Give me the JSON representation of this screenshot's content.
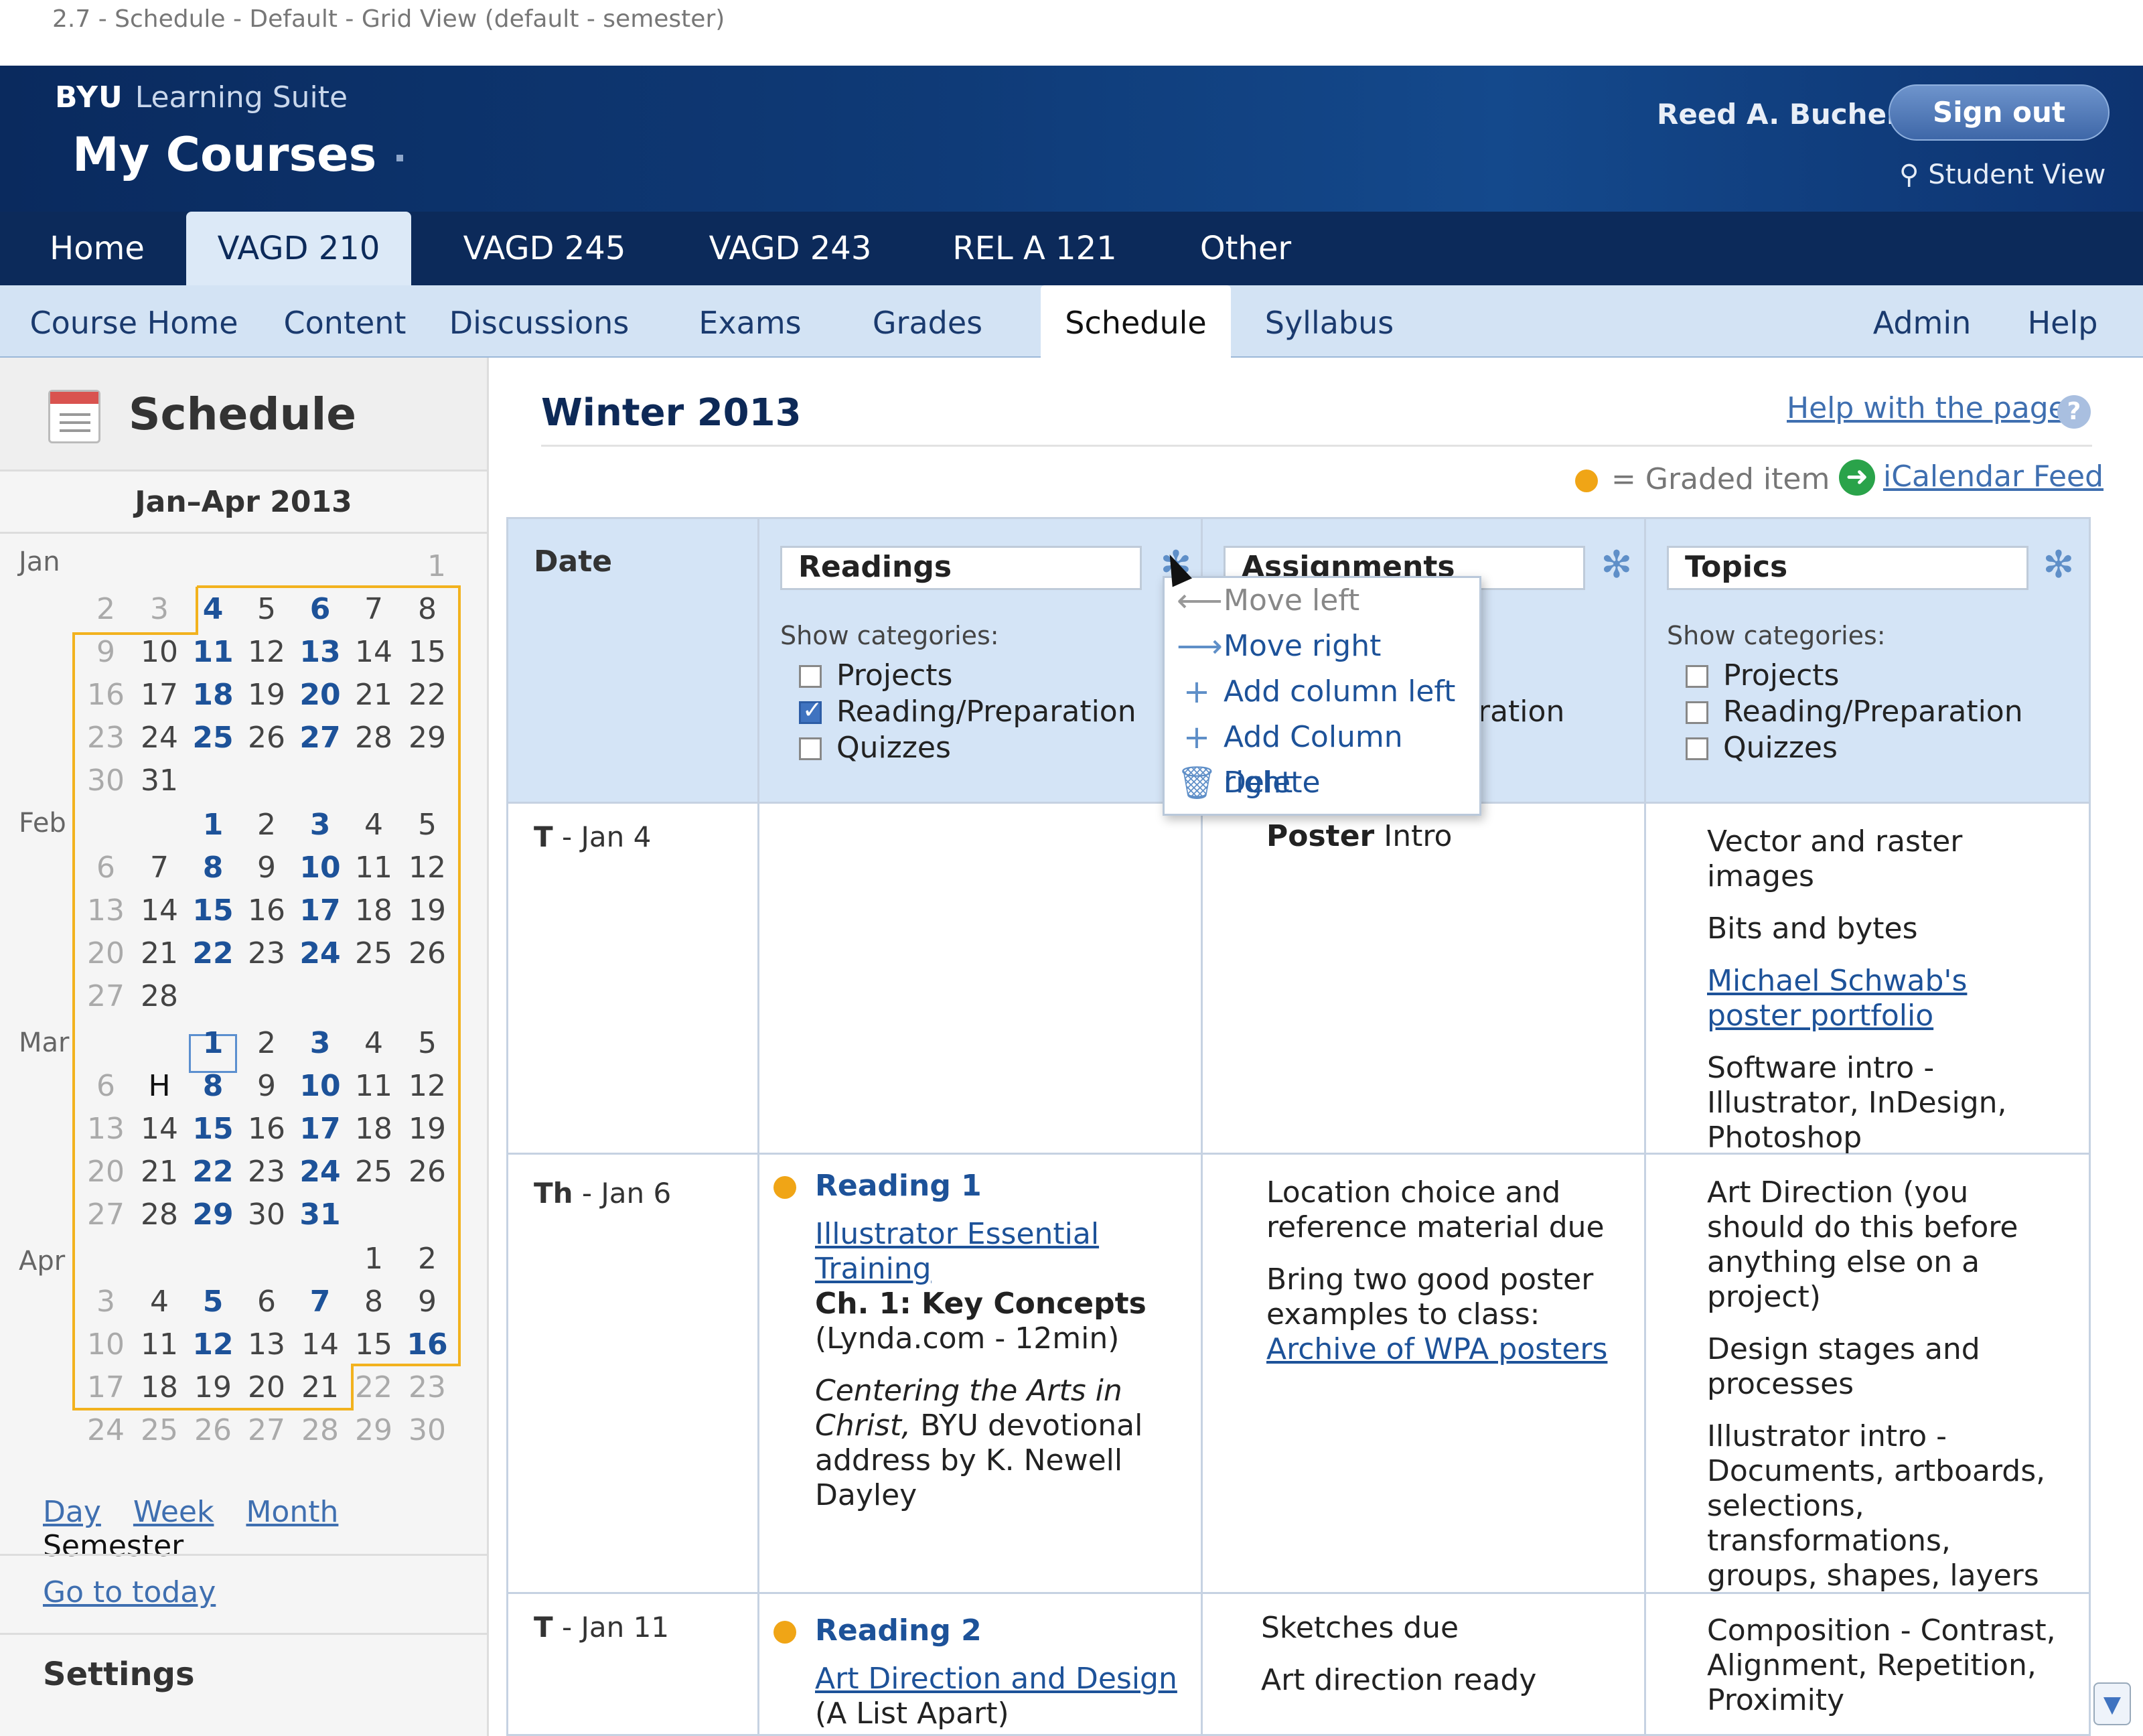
{
  "caption": "2.7 - Schedule - Default - Grid View (default - semester)",
  "header": {
    "brand_byu": "BYU",
    "brand_suite": "Learning Suite",
    "title": "My Courses",
    "user_name": "Reed A. Bucher",
    "sign_out": "Sign out",
    "student_view": "Student View"
  },
  "course_tabs": [
    "Home",
    "VAGD 210",
    "VAGD 245",
    "VAGD 243",
    "REL A 121",
    "Other"
  ],
  "sub_tabs": [
    "Course Home",
    "Content",
    "Discussions",
    "Exams",
    "Grades",
    "Schedule",
    "Syllabus"
  ],
  "sub_right": {
    "admin": "Admin",
    "help": "Help"
  },
  "sidebar": {
    "title": "Schedule",
    "range": "Jan–Apr  2013",
    "months": [
      "Jan",
      "Feb",
      "Mar",
      "Apr"
    ],
    "views": {
      "day": "Day",
      "week": "Week",
      "month": "Month",
      "semester": "Semester"
    },
    "go_today": "Go to today",
    "settings": "Settings"
  },
  "main": {
    "term": "Winter 2013",
    "help": "Help with the page",
    "help_icon": "?",
    "graded_legend": "= Graded item",
    "ical": "iCalendar Feed"
  },
  "grid": {
    "date_header": "Date",
    "columns": [
      {
        "title": "Readings",
        "show_categories": "Show categories:",
        "categories": [
          {
            "label": "Projects",
            "checked": false
          },
          {
            "label": "Reading/Preparation",
            "checked": true
          },
          {
            "label": "Quizzes",
            "checked": false
          }
        ]
      },
      {
        "title": "Assignments",
        "partial_category": "ration"
      },
      {
        "title": "Topics",
        "show_categories": "Show categories:",
        "categories": [
          {
            "label": "Projects",
            "checked": false
          },
          {
            "label": "Reading/Preparation",
            "checked": false
          },
          {
            "label": "Quizzes",
            "checked": false
          }
        ]
      }
    ],
    "rows": [
      {
        "day": "T",
        "date": " - Jan 4",
        "assignments_bold": "Poster",
        "assignments_rest": " Intro",
        "topics": [
          "Vector and raster images",
          "Bits and bytes",
          "Michael Schwab's poster portfolio",
          "Software intro - Illustrator, InDesign, Photoshop"
        ]
      },
      {
        "day": "Th",
        "date": " - Jan 6",
        "reading_title": "Reading 1",
        "reading_link": "Illustrator Essential Training",
        "reading_bold": "Ch. 1: Key Concepts",
        "reading_src": "(Lynda.com - 12min)",
        "reading_italic": "Centering the Arts in Christ,",
        "reading_rest": "BYU devotional address by K. Newell Dayley",
        "assign_1": "Location choice and reference material due",
        "assign_2_text": "Bring two good poster examples to class: ",
        "assign_2_link": "Archive of WPA posters",
        "topics": [
          "Art Direction (you should do this before anything else on a project)",
          "Design stages and processes",
          "Illustrator intro - Documents, artboards, selections, transformations, groups, shapes, layers"
        ]
      },
      {
        "day": "T",
        "date": " - Jan 11",
        "reading_title": "Reading 2",
        "reading_link": "Art Direction and Design",
        "reading_src": "(A List Apart)",
        "assign_1": "Sketches due",
        "assign_2": "Art direction ready",
        "topics": [
          "Composition - Contrast, Alignment, Repetition, Proximity"
        ]
      }
    ]
  },
  "menu": {
    "move_left": "Move left",
    "move_right": "Move right",
    "add_left": "Add column left",
    "add_right": "Add Column right",
    "delete": "Delete"
  },
  "colors": {
    "graded_dot": "#f0a516",
    "header_bg": "#0f3b78",
    "link": "#1d5299"
  }
}
